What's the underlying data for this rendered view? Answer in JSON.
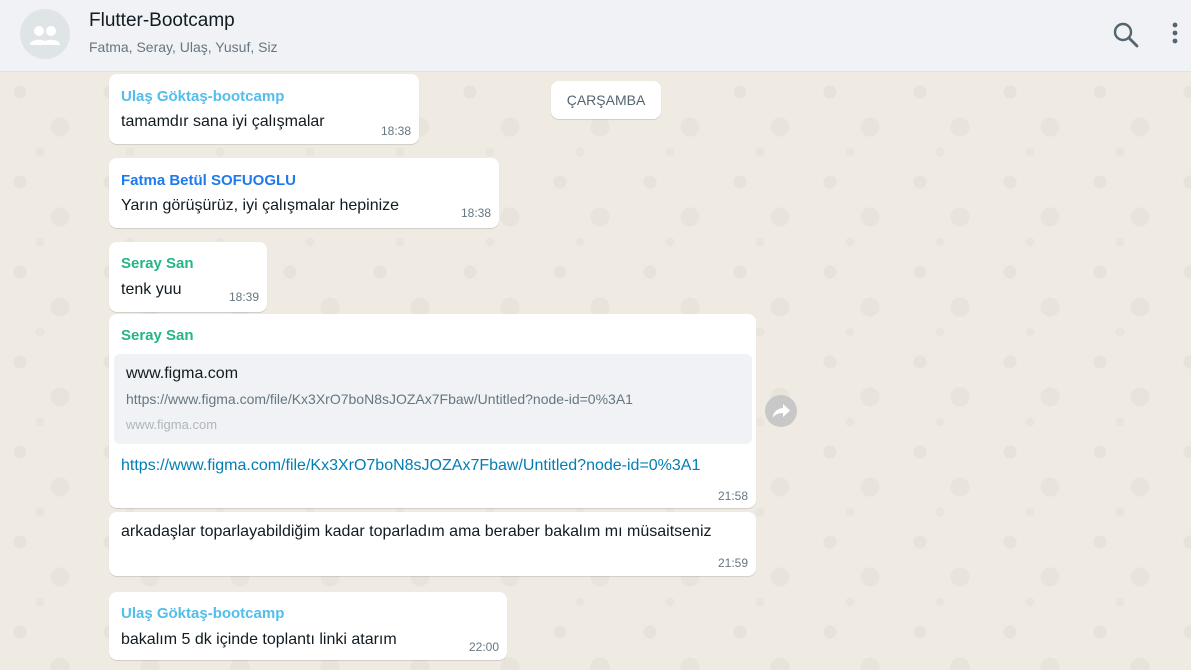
{
  "header": {
    "title": "Flutter-Bootcamp",
    "members": "Fatma, Seray, Ulaş, Yusuf, Siz"
  },
  "date_separator": "ÇARŞAMBA",
  "messages": [
    {
      "sender": "Ulaş Göktaş-bootcamp",
      "sender_color": "#53bdeb",
      "text": "tamamdır sana iyi çalışmalar",
      "time": "18:38"
    },
    {
      "sender": "Fatma Betül SOFUOGLU",
      "sender_color": "#1f7aec",
      "text": "Yarın görüşürüz, iyi çalışmalar hepinize",
      "time": "18:38"
    },
    {
      "sender": "Seray San",
      "sender_color": "#25b586",
      "text": "tenk yuu",
      "time": "18:39"
    },
    {
      "sender": "Seray San",
      "sender_color": "#25b586",
      "link_preview": {
        "title": "www.figma.com",
        "url": "https://www.figma.com/file/Kx3XrO7boN8sJOZAx7Fbaw/Untitled?node-id=0%3A1",
        "domain": "www.figma.com"
      },
      "text": "https://www.figma.com/file/Kx3XrO7boN8sJOZAx7Fbaw/Untitled?node-id=0%3A1",
      "time": "21:58"
    },
    {
      "text": "arkadaşlar toparlayabildiğim kadar toparladım ama beraber bakalım mı müsaitseniz",
      "time": "21:59"
    },
    {
      "sender": "Ulaş Göktaş-bootcamp",
      "sender_color": "#53bdeb",
      "text": "bakalım 5 dk içinde toplantı linki atarım",
      "time": "22:00"
    }
  ],
  "icons": {
    "avatar": "group-avatar-icon",
    "search": "search-icon",
    "menu": "kebab-menu-icon",
    "forward": "forward-icon"
  }
}
